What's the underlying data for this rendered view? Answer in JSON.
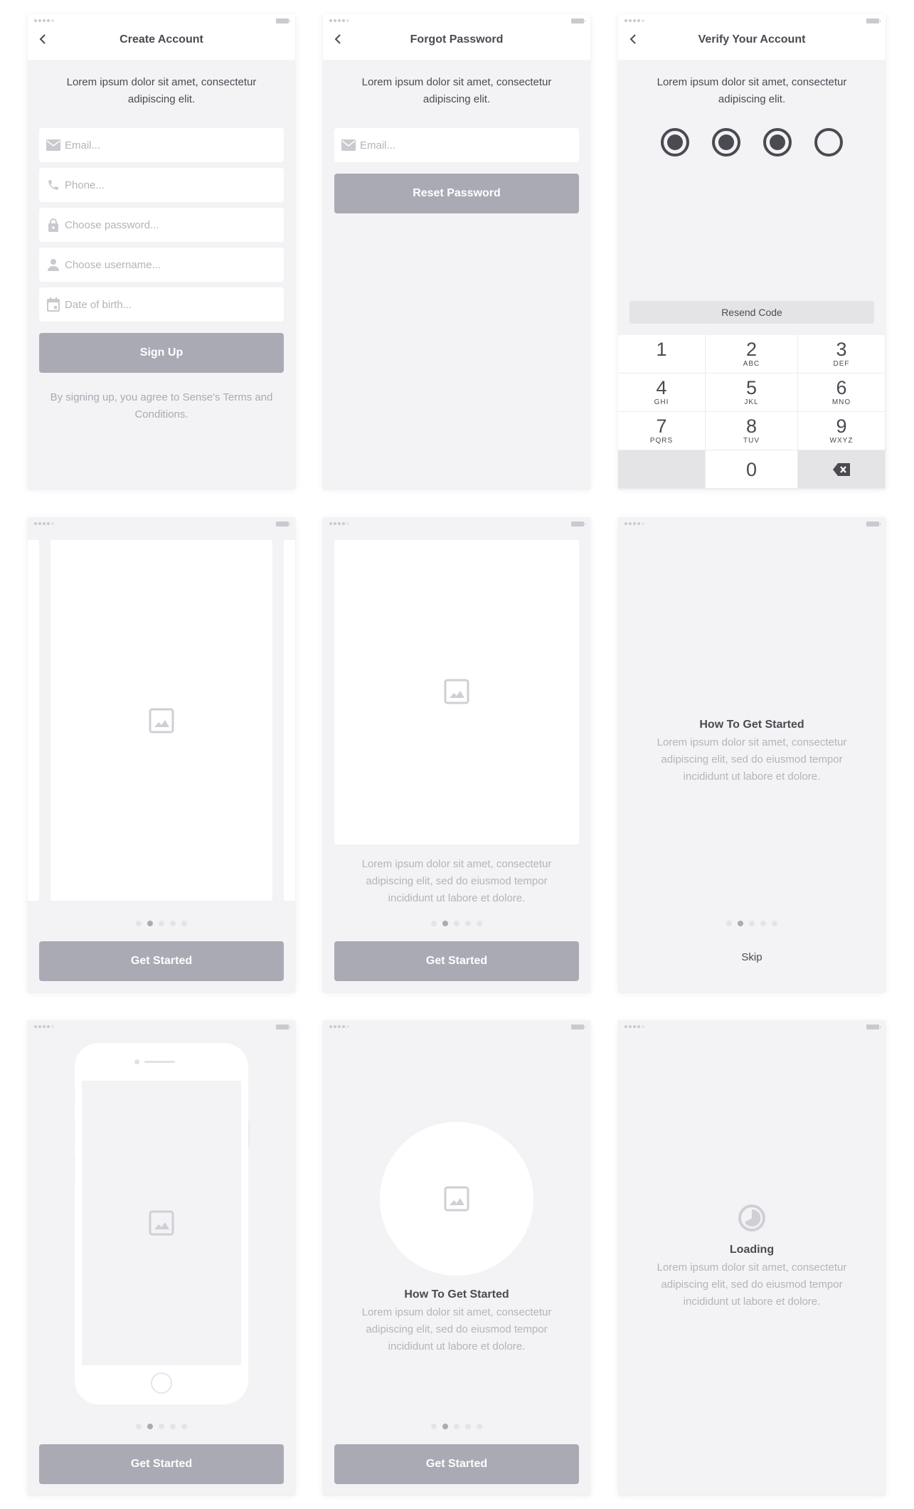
{
  "status_bar": {
    "signal_bars_on": 4,
    "signal_bars_total": 5,
    "battery_icon": "battery-icon"
  },
  "create_account": {
    "title": "Create Account",
    "back_icon": "chevron-left-icon",
    "intro": "Lorem ipsum dolor sit amet, consectetur adipiscing elit.",
    "fields": [
      {
        "icon": "mail-icon",
        "placeholder": "Email...",
        "value": ""
      },
      {
        "icon": "phone-icon",
        "placeholder": "Phone...",
        "value": ""
      },
      {
        "icon": "lock-icon",
        "placeholder": "Choose password...",
        "value": ""
      },
      {
        "icon": "user-icon",
        "placeholder": "Choose username...",
        "value": ""
      },
      {
        "icon": "calendar-icon",
        "placeholder": "Date of birth...",
        "value": ""
      }
    ],
    "submit_label": "Sign Up",
    "terms": "By signing up, you agree to Sense's Terms and Conditions."
  },
  "forgot_password": {
    "title": "Forgot Password",
    "back_icon": "chevron-left-icon",
    "intro": "Lorem ipsum dolor sit amet, consectetur adipiscing elit.",
    "email": {
      "icon": "mail-icon",
      "placeholder": "Email...",
      "value": ""
    },
    "submit_label": "Reset Password"
  },
  "verify_account": {
    "title": "Verify Your Account",
    "back_icon": "chevron-left-icon",
    "intro": "Lorem ipsum dolor sit amet, consectetur adipiscing elit.",
    "code_length": 4,
    "code_filled": 3,
    "resend_label": "Resend Code",
    "keypad": [
      {
        "num": "1",
        "letters": ""
      },
      {
        "num": "2",
        "letters": "ABC"
      },
      {
        "num": "3",
        "letters": "DEF"
      },
      {
        "num": "4",
        "letters": "GHI"
      },
      {
        "num": "5",
        "letters": "JKL"
      },
      {
        "num": "6",
        "letters": "MNO"
      },
      {
        "num": "7",
        "letters": "PQRS"
      },
      {
        "num": "8",
        "letters": "TUV"
      },
      {
        "num": "9",
        "letters": "WXYZ"
      },
      {
        "num": "",
        "letters": ""
      },
      {
        "num": "0",
        "letters": ""
      },
      {
        "num": "",
        "letters": "",
        "icon": "backspace-icon"
      }
    ]
  },
  "onboarding_card": {
    "image_icon": "image-icon",
    "pager": {
      "total": 5,
      "active": 2
    },
    "button_label": "Get Started"
  },
  "onboarding_card_text": {
    "image_icon": "image-icon",
    "body": "Lorem ipsum dolor sit amet, consectetur adipiscing elit, sed do eiusmod tempor incididunt ut labore et dolore.",
    "pager": {
      "total": 5,
      "active": 2
    },
    "button_label": "Get Started"
  },
  "onboarding_text": {
    "heading": "How To Get Started",
    "body": "Lorem ipsum dolor sit amet, consectetur adipiscing elit, sed do eiusmod tempor incididunt ut labore et dolore.",
    "pager": {
      "total": 5,
      "active": 2
    },
    "skip_label": "Skip"
  },
  "onboarding_phone": {
    "image_icon": "image-icon",
    "pager": {
      "total": 5,
      "active": 2
    },
    "button_label": "Get Started"
  },
  "onboarding_circle": {
    "image_icon": "image-icon",
    "heading": "How To Get Started",
    "body": "Lorem ipsum dolor sit amet, consectetur adipiscing elit, sed do eiusmod tempor incididunt ut labore et dolore.",
    "pager": {
      "total": 5,
      "active": 2
    },
    "button_label": "Get Started"
  },
  "loading": {
    "icon": "loading-icon",
    "heading": "Loading",
    "body": "Lorem ipsum dolor sit amet, consectetur adipiscing elit, sed do eiusmod tempor incididunt ut labore et dolore."
  },
  "colors": {
    "screen_bg": "#f3f3f6",
    "primary_button": "#aaaab4",
    "text_dark": "#4a4a52",
    "text_muted": "#b3b3bb",
    "icon_muted": "#c9c9cf"
  }
}
